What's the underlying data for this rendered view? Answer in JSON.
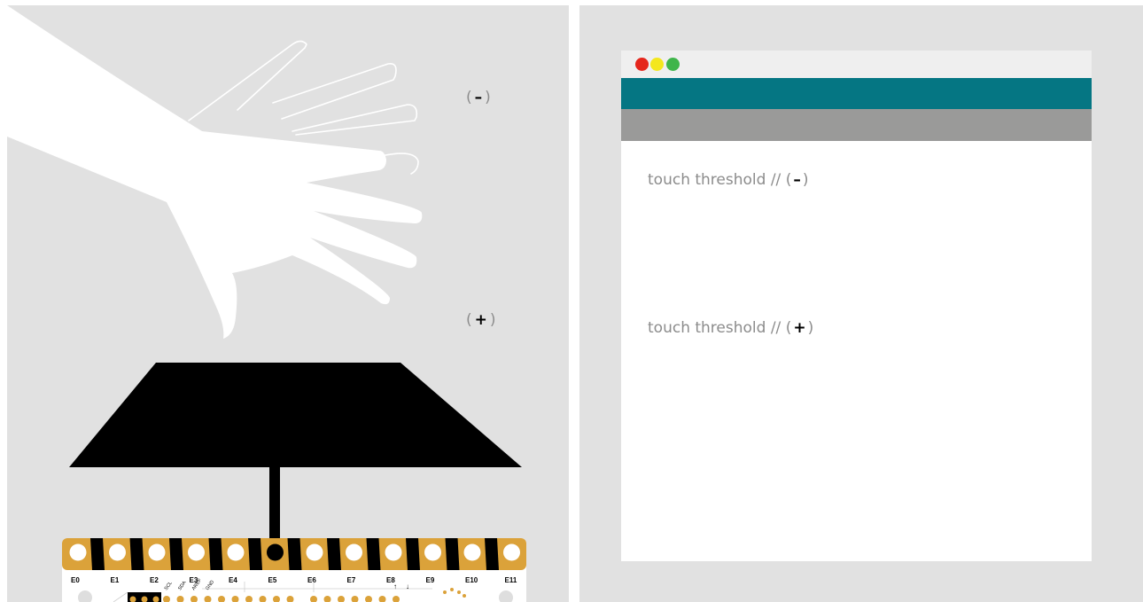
{
  "left_panel": {
    "minus_marker": {
      "open": "(",
      "symbol": "–",
      "close": ")"
    },
    "plus_marker": {
      "open": "(",
      "symbol": "+",
      "close": ")"
    },
    "board": {
      "pad_labels": [
        "E0",
        "E1",
        "E2",
        "E3",
        "E4",
        "E5",
        "E6",
        "E7",
        "E8",
        "E9",
        "E10",
        "E11"
      ],
      "pin_labels": [
        "SCL",
        "SDA",
        "AREF",
        "GND"
      ],
      "active_pad": "E5"
    }
  },
  "window": {
    "traffic_lights": {
      "close_color": "#e5261c",
      "minimize_color": "#f4e71d",
      "maximize_color": "#3fb54a"
    },
    "toolbar_color": "#057683",
    "subtoolbar_color": "#9a9a99",
    "console": {
      "line1": {
        "text": "touch threshold //",
        "open": "(",
        "symbol": "–",
        "close": ")"
      },
      "line2": {
        "text": "touch threshold //",
        "open": "(",
        "symbol": "+",
        "close": ")"
      }
    }
  },
  "colors": {
    "background": "#e1e1e1",
    "board_gold": "#dba23a",
    "hand": "#ffffff",
    "electrode": "#000000"
  }
}
